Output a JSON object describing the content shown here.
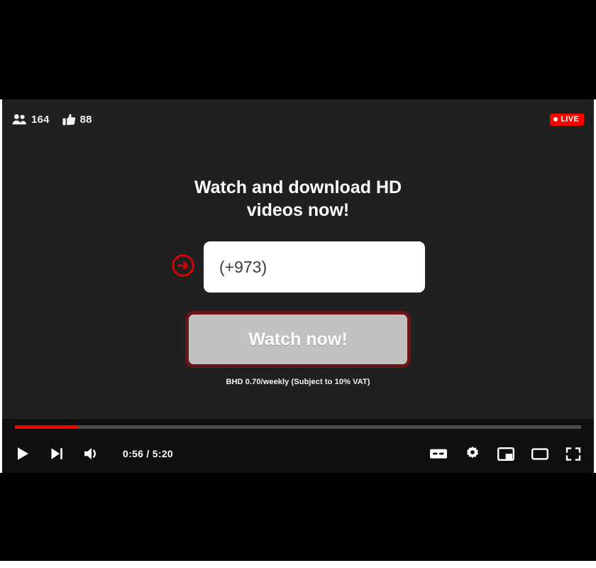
{
  "player": {
    "stats": [
      {
        "icon": "people-icon",
        "value": "164"
      },
      {
        "icon": "thumbs-up-icon",
        "value": "88"
      }
    ],
    "live_badge": "LIVE",
    "accent_color": "#ff0000",
    "background_color": "#202020",
    "control_bar_color": "#0f0f0f"
  },
  "promo": {
    "title": "Watch and download HD videos now!",
    "phone_value": "(+973)",
    "phone_placeholder": "(+973)",
    "cta_label": "Watch now!",
    "cta_border_color": "#6b1616",
    "cta_fill_color": "#c2c2c2",
    "fine_print": "BHD 0.70/weekly (Subject to 10% VAT)"
  },
  "controls": {
    "progress_percent": 11,
    "time": "0:56 / 5:20",
    "current_time": "0:56",
    "duration": "5:20",
    "left_buttons": [
      {
        "name": "play-button",
        "icon": "play-icon"
      },
      {
        "name": "next-button",
        "icon": "next-track-icon"
      },
      {
        "name": "volume-button",
        "icon": "volume-icon"
      }
    ],
    "right_buttons": [
      {
        "name": "captions-button",
        "icon": "cc-icon"
      },
      {
        "name": "settings-button",
        "icon": "gear-icon"
      },
      {
        "name": "miniplayer-button",
        "icon": "miniplayer-icon"
      },
      {
        "name": "theater-button",
        "icon": "theater-mode-icon"
      },
      {
        "name": "fullscreen-button",
        "icon": "fullscreen-icon"
      }
    ]
  }
}
